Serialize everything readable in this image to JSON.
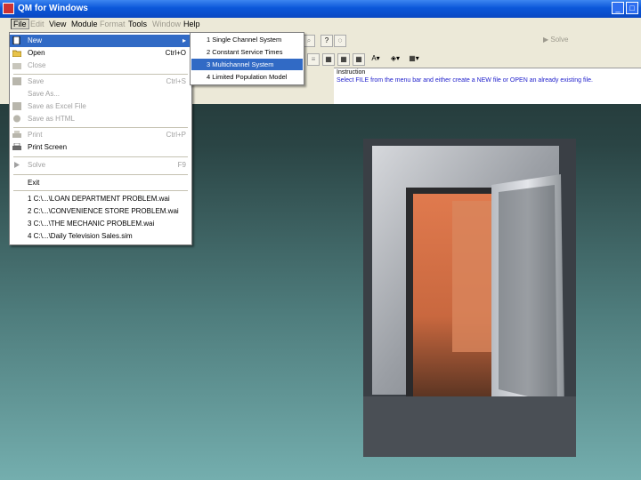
{
  "window": {
    "title": "QM for Windows",
    "minimize": "_",
    "maximize": "□",
    "close": "✕"
  },
  "menubar": {
    "items": [
      {
        "label": "File",
        "state": "active"
      },
      {
        "label": "Edit",
        "state": "disabled"
      },
      {
        "label": "View",
        "state": "normal"
      },
      {
        "label": "Module",
        "state": "normal"
      },
      {
        "label": "Format",
        "state": "disabled"
      },
      {
        "label": "Tools",
        "state": "normal"
      },
      {
        "label": "Window",
        "state": "disabled"
      },
      {
        "label": "Help",
        "state": "normal"
      }
    ]
  },
  "file_menu": {
    "new": {
      "label": "New",
      "arrow": "▸"
    },
    "open": {
      "label": "Open",
      "shortcut": "Ctrl+O"
    },
    "close": {
      "label": "Close"
    },
    "save": {
      "label": "Save",
      "shortcut": "Ctrl+S"
    },
    "save_as": {
      "label": "Save As..."
    },
    "save_excel": {
      "label": "Save as Excel File"
    },
    "save_html": {
      "label": "Save as HTML"
    },
    "print": {
      "label": "Print",
      "shortcut": "Ctrl+P"
    },
    "print_screen": {
      "label": "Print Screen"
    },
    "solve": {
      "label": "Solve",
      "shortcut": "F9"
    },
    "exit": {
      "label": "Exit"
    },
    "recent": [
      "1 C:\\...\\LOAN DEPARTMENT PROBLEM.wai",
      "2 C:\\...\\CONVENIENCE STORE PROBLEM.wai",
      "3 C:\\...\\THE MECHANIC PROBLEM.wai",
      "4 C:\\...\\Daily Television Sales.sim"
    ]
  },
  "new_submenu": {
    "items": [
      "1 Single Channel System",
      "2 Constant Service Times",
      "3 Multichannel System",
      "4 Limited Population Model"
    ],
    "selected_index": 2
  },
  "toolbar": {
    "solve_label": "Solve",
    "help_glyph": "?"
  },
  "instruction": {
    "title": "Instruction",
    "text": "Select FILE from the menu bar and either create a NEW file or OPEN an already existing file."
  },
  "colors": {
    "titlebar": "#0b57d9",
    "menu_highlight": "#316ac5",
    "menu_bg": "#ece9d8"
  },
  "photo": {
    "subject": "bank vault door open",
    "icon": "vault-photo"
  }
}
